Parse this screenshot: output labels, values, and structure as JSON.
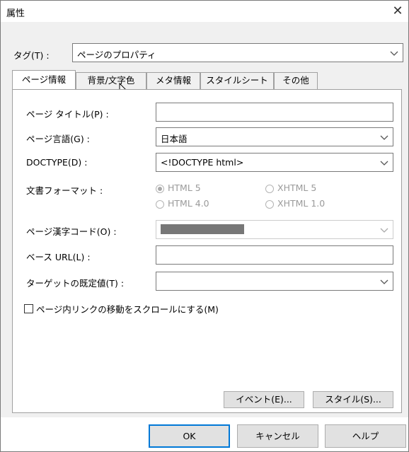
{
  "window": {
    "title": "属性",
    "close_glyph": "✕"
  },
  "tag_row": {
    "label": "タグ(T) :",
    "value": "ページのプロパティ"
  },
  "tabs": [
    {
      "label": "ページ情報",
      "active": true
    },
    {
      "label": "背景/文字色",
      "active": false
    },
    {
      "label": "メタ情報",
      "active": false
    },
    {
      "label": "スタイルシート",
      "active": false
    },
    {
      "label": "その他",
      "active": false
    }
  ],
  "fields": {
    "page_title": {
      "label": "ページ タイトル(P) :",
      "value": ""
    },
    "page_language": {
      "label": "ページ言語(G) :",
      "value": "日本語"
    },
    "doctype": {
      "label": "DOCTYPE(D) :",
      "value": "<!DOCTYPE html>"
    },
    "doc_format": {
      "label": "文書フォーマット :",
      "options": [
        {
          "label": "HTML 5",
          "selected": true
        },
        {
          "label": "XHTML 5",
          "selected": false
        },
        {
          "label": "HTML 4.0",
          "selected": false
        },
        {
          "label": "XHTML 1.0",
          "selected": false
        }
      ]
    },
    "kanji_code": {
      "label": "ページ漢字コード(O) :",
      "value": ""
    },
    "base_url": {
      "label": "ベース URL(L) :",
      "value": ""
    },
    "default_target": {
      "label": "ターゲットの既定値(T) :",
      "value": ""
    }
  },
  "checkbox": {
    "label": "ページ内リンクの移動をスクロールにする(M)",
    "checked": false
  },
  "panel_buttons": {
    "event": "イベント(E)...",
    "style": "スタイル(S)..."
  },
  "footer_buttons": {
    "ok": "OK",
    "cancel": "キャンセル",
    "help": "ヘルプ"
  },
  "colors": {
    "accent": "#0078d7",
    "panel_bg": "#f0f0f0",
    "masked": "#777777"
  }
}
